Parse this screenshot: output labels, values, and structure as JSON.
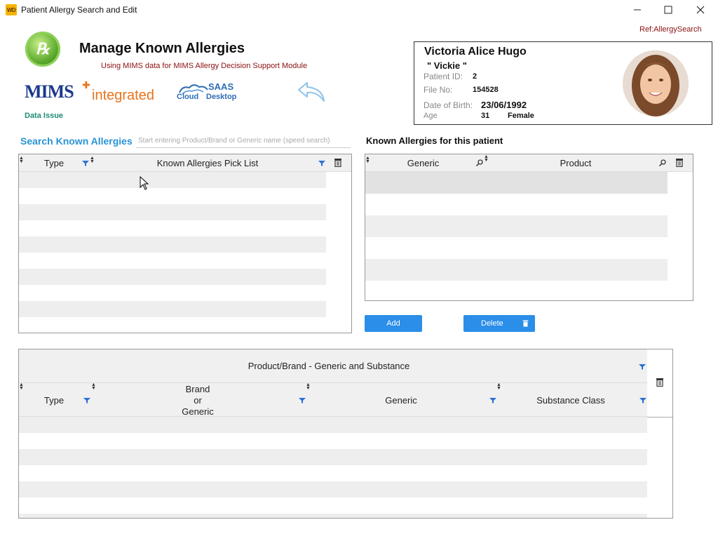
{
  "window": {
    "app_icon_text": "WD",
    "title": "Patient Allergy Search and Edit",
    "minimize": "—",
    "maximize": "☐",
    "close": "✕"
  },
  "header": {
    "ref": "Ref:AllergySearch",
    "title": "Manage Known Allergies",
    "subtitle": "Using MIMS data for MIMS Allergy Decision Support Module",
    "mims_logo": "MIMS",
    "mims_integrated": "integrated",
    "saas_word": "SAAS",
    "saas_cloud": "Cloud",
    "saas_desktop": "Desktop",
    "data_issue": "Data Issue"
  },
  "patient": {
    "name": "Victoria Alice Hugo",
    "nickname": "\" Vickie \"",
    "id_label": "Patient ID:",
    "id": "2",
    "file_label": "File No:",
    "file_no": "154528",
    "dob_label": "Date of Birth:",
    "dob": "23/06/1992",
    "age_label": "Age",
    "age": "31",
    "sex": "Female"
  },
  "search": {
    "label": "Search Known Allergies",
    "placeholder": "Start entering Product/Brand or Generic name (speed search)"
  },
  "pick_list": {
    "col_type": "Type",
    "col_list": "Known Allergies Pick List",
    "rows": 10
  },
  "known": {
    "label": "Known Allergies for this patient",
    "col_generic": "Generic",
    "col_product": "Product",
    "add": "Add",
    "delete": "Delete"
  },
  "product_grid": {
    "group_header": "Product/Brand - Generic and Substance",
    "col_type": "Type",
    "col_brand_1": "Brand",
    "col_brand_2": "or",
    "col_brand_3": "Generic",
    "col_generic": "Generic",
    "col_substance": "Substance Class"
  },
  "colors": {
    "accent_blue": "#2b8ee8",
    "title_blue": "#2a93d5",
    "dark_red": "#8b1010",
    "teal": "#1e8c7a",
    "row_alt": "#eeeeee"
  }
}
